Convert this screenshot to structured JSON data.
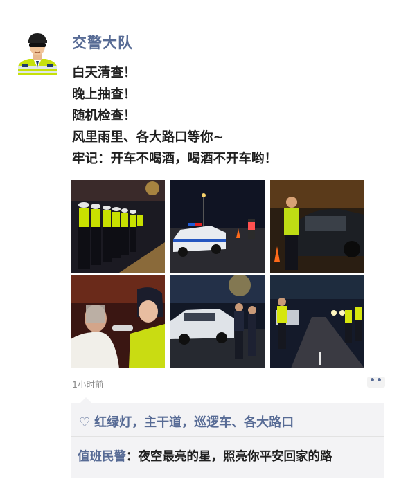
{
  "post": {
    "author": "交警大队",
    "lines": [
      "白天清查！",
      "晚上抽查！",
      "随机检查！",
      "风里雨里、各大路口等你~",
      "牢记：开车不喝酒，喝酒不开车哟！"
    ],
    "timestamp": "1小时前",
    "more_label": "••"
  },
  "photos": [
    {
      "id": "p1",
      "scene": "officers-lined-up-night"
    },
    {
      "id": "p2",
      "scene": "police-car-at-checkpoint"
    },
    {
      "id": "p3",
      "scene": "officer-checking-car"
    },
    {
      "id": "p4",
      "scene": "breathalyzer-test"
    },
    {
      "id": "p5",
      "scene": "officers-by-white-car"
    },
    {
      "id": "p6",
      "scene": "road-checkpoint-officers"
    }
  ],
  "interactions": {
    "likes_text": "红绿灯，主干道，巡逻车、各大路口",
    "heart_icon": "♡",
    "comments": [
      {
        "author": "值班民警",
        "separator": "：",
        "text": "夜空最亮的星，照亮你平安回家的路"
      }
    ]
  },
  "colors": {
    "link": "#576b95",
    "text": "#1f1f1f",
    "panel": "#f3f3f5",
    "vest": "#c8e600"
  }
}
